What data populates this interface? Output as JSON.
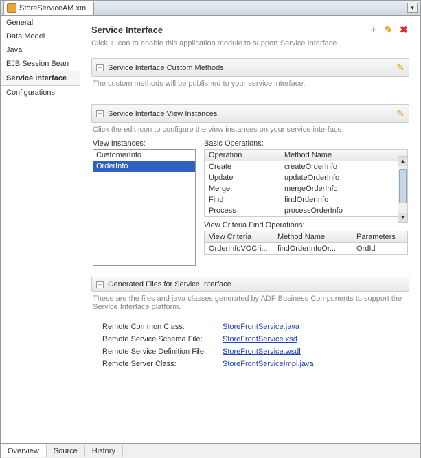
{
  "file_tab": "StoreServiceAM.xml",
  "sidebar": {
    "items": [
      "General",
      "Data Model",
      "Java",
      "EJB Session Bean",
      "Service Interface",
      "Configurations"
    ],
    "selected": 4
  },
  "page": {
    "title": "Service Interface",
    "subtitle": "Click + icon to enable this application module to support Service Interface."
  },
  "sections": {
    "custom": {
      "title": "Service Interface Custom Methods",
      "desc": "The custom methods will be published to your service interface."
    },
    "view": {
      "title": "Service Interface View Instances",
      "desc": "Click the edit icon to configure the view instances on your service interface.",
      "view_instances_label": "View Instances:",
      "view_instances": [
        "CustomerInfo",
        "OrderInfo"
      ],
      "selected_instance": 1,
      "basic_ops_label": "Basic Operations:",
      "basic_ops_cols": {
        "op": "Operation",
        "mn": "Method Name"
      },
      "basic_ops": [
        {
          "op": "Create",
          "mn": "createOrderInfo"
        },
        {
          "op": "Update",
          "mn": "updateOrderInfo"
        },
        {
          "op": "Merge",
          "mn": "mergeOrderInfo"
        },
        {
          "op": "Find",
          "mn": "findOrderInfo"
        },
        {
          "op": "Process",
          "mn": "processOrderInfo"
        }
      ],
      "criteria_label": "View Criteria Find Operations:",
      "criteria_cols": {
        "vc": "View Criteria",
        "mn": "Method Name",
        "pr": "Parameters"
      },
      "criteria": [
        {
          "vc": "OrderInfoVOCri...",
          "mn": "findOrderInfoOr...",
          "pr": "OrdId"
        }
      ]
    },
    "gen": {
      "title": "Generated Files for Service Interface",
      "desc": "These are the files and java classes generated by ADF Business Components to support the Service Interface platform.",
      "rows": [
        {
          "label": "Remote Common Class:",
          "link": "StoreFrontService.java"
        },
        {
          "label": "Remote Service Schema File:",
          "link": "StoreFrontService.xsd"
        },
        {
          "label": "Remote Service Definition File:",
          "link": "StoreFrontService.wsdl"
        },
        {
          "label": "Remote Server Class:",
          "link": "StoreFrontServiceImpl.java"
        }
      ]
    }
  },
  "footer_tabs": [
    "Overview",
    "Source",
    "History"
  ],
  "footer_active": 0
}
